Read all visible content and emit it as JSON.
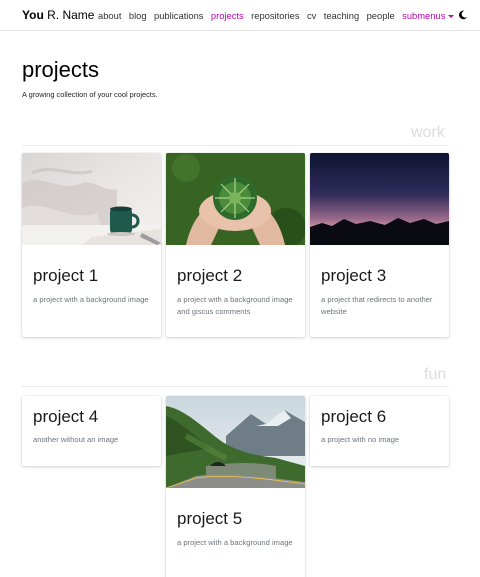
{
  "navbar": {
    "brand_bold": "You",
    "brand_rest": "R. Name",
    "links": [
      "about",
      "blog",
      "publications",
      "projects",
      "repositories",
      "cv",
      "teaching",
      "people"
    ],
    "active": "projects",
    "submenus_label": "submenus",
    "theme_icon": "moon-icon"
  },
  "header": {
    "title": "projects",
    "description": "A growing collection of your cool projects."
  },
  "categories": [
    {
      "name": "work",
      "projects": [
        {
          "title": "project 1",
          "description": "a project with a background image",
          "image": "mug-on-bed-photo"
        },
        {
          "title": "project 2",
          "description": "a project with a background image and giscus comments",
          "image": "hands-holding-plant-photo"
        },
        {
          "title": "project 3",
          "description": "a project that redirects to another website",
          "image": "mountain-sunset-photo"
        }
      ]
    },
    {
      "name": "fun",
      "projects": [
        {
          "title": "project 4",
          "description": "another without an image"
        },
        {
          "title": "project 5",
          "description": "a project with a background image",
          "image": "mountain-road-tunnel-photo"
        },
        {
          "title": "project 6",
          "description": "a project with no image"
        }
      ]
    }
  ],
  "colors": {
    "accent": "#b509ac",
    "category_label": "#dcdcdc"
  }
}
